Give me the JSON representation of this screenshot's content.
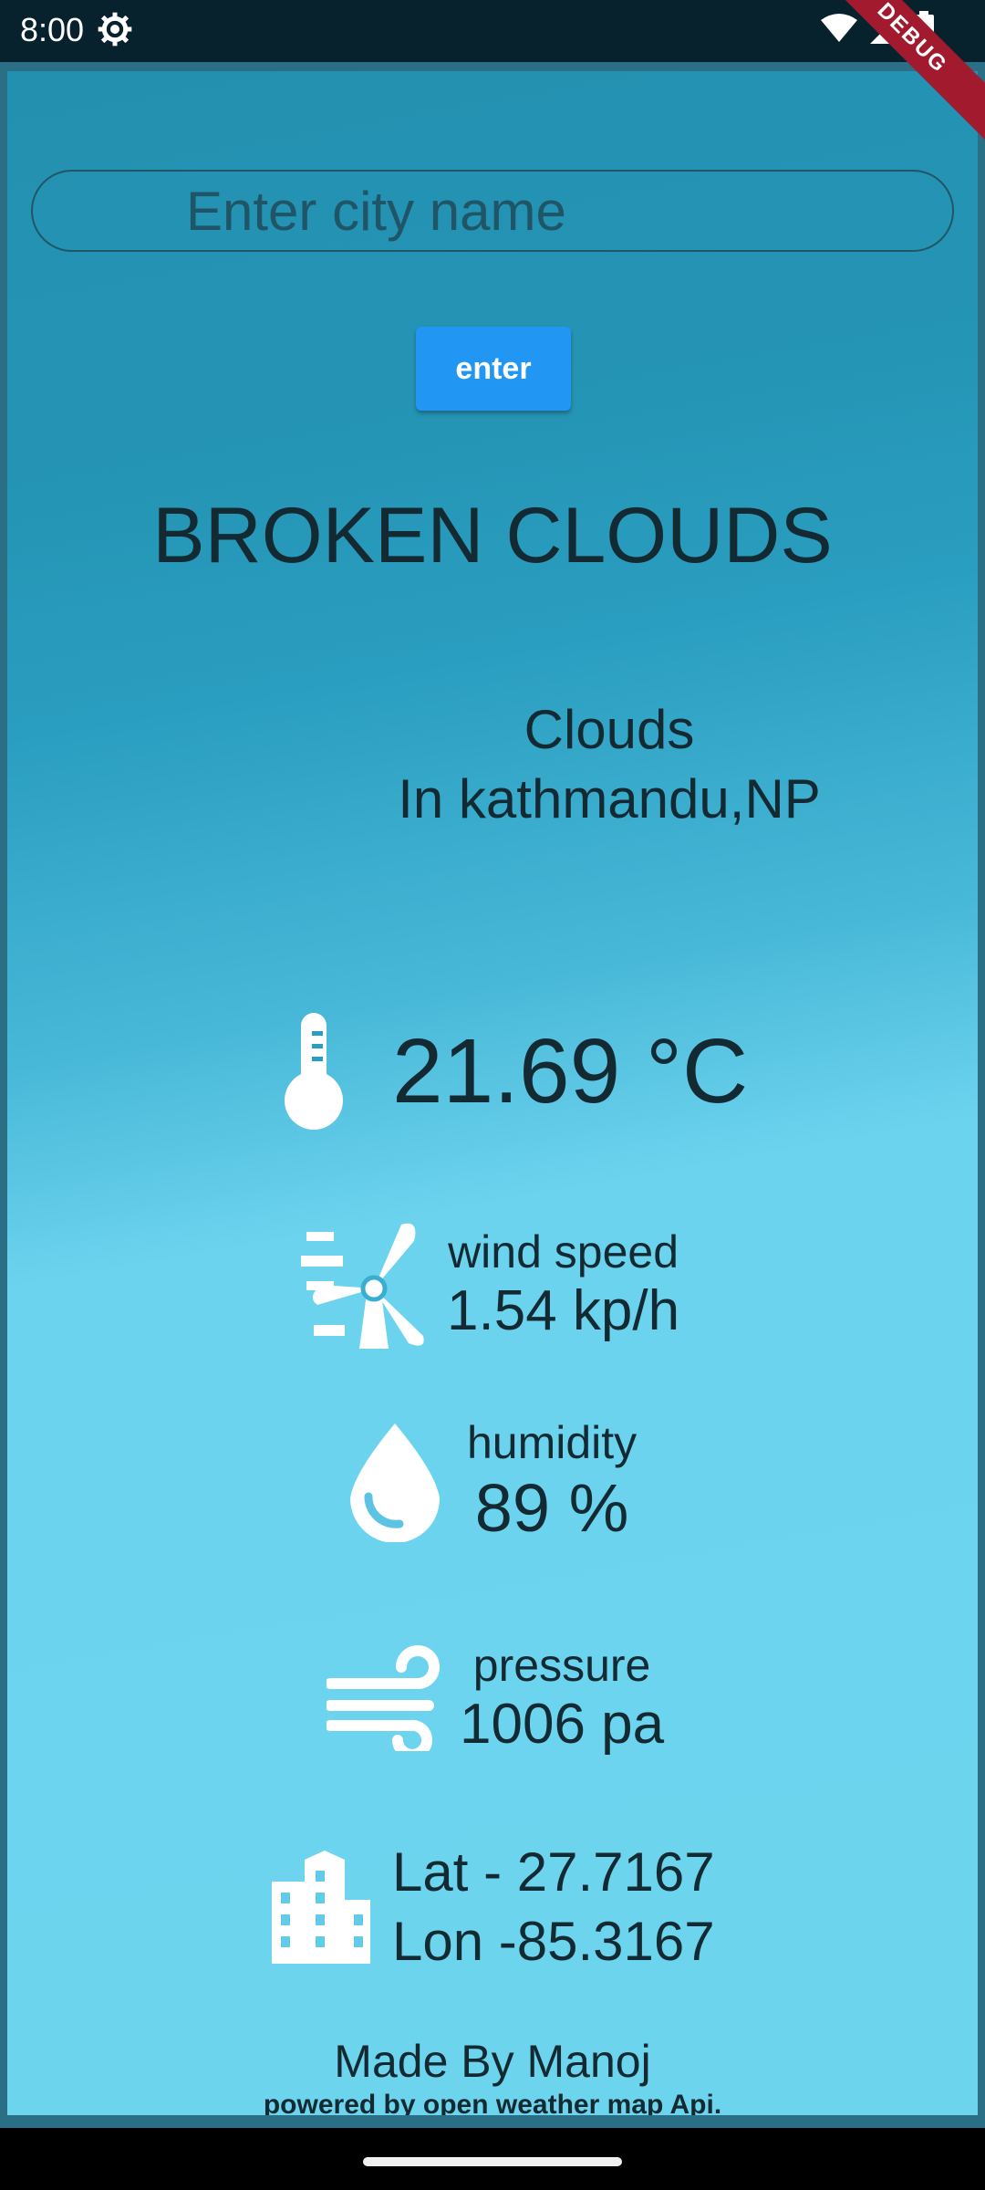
{
  "status_bar": {
    "time": "8:00",
    "icons": [
      "settings-gear-icon",
      "wifi-icon",
      "cell-signal-icon",
      "battery-icon"
    ]
  },
  "debug_banner": "DEBUG",
  "search": {
    "placeholder": "Enter city name",
    "value": ""
  },
  "enter_button": {
    "label": "enter"
  },
  "weather": {
    "description": "BROKEN CLOUDS",
    "main": "Clouds",
    "location_line": "In kathmandu,NP",
    "temperature": "21.69 °C",
    "wind": {
      "label": "wind speed",
      "value": "1.54 kp/h"
    },
    "humidity": {
      "label": "humidity",
      "value": "89 %"
    },
    "pressure": {
      "label": "pressure",
      "value": "1006 pa"
    },
    "coords": {
      "lat": "Lat - 27.7167",
      "lon": "Lon -85.3167"
    }
  },
  "footer": {
    "author": "Made By Manoj",
    "powered_by": "powered by open weather map Api."
  },
  "colors": {
    "button": "#2196f3",
    "text_dark": "#142a33",
    "gradient_top": "#2490b0",
    "gradient_bottom": "#6dd4ee"
  }
}
